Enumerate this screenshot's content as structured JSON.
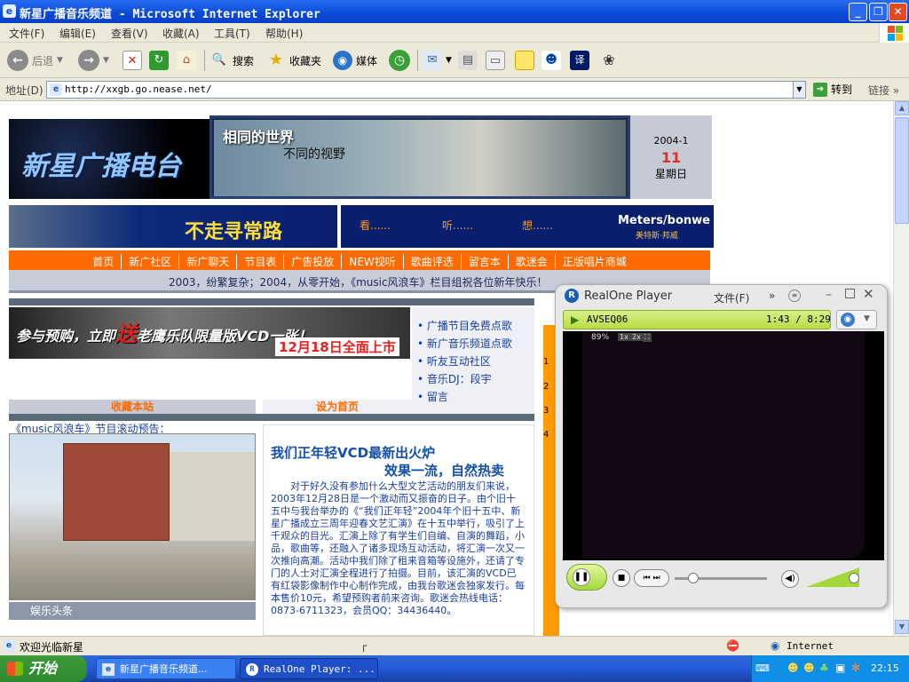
{
  "window": {
    "title": "新星广播音乐频道 - Microsoft Internet Explorer",
    "ie_icon": "ie-icon"
  },
  "menu": [
    "文件(F)",
    "编辑(E)",
    "查看(V)",
    "收藏(A)",
    "工具(T)",
    "帮助(H)"
  ],
  "toolbar": {
    "back": "后退",
    "search": "搜索",
    "favorites": "收藏夹",
    "media": "媒体"
  },
  "address": {
    "label": "地址(D)",
    "url": "http://xxgb.go.nease.net/",
    "go": "转到",
    "links": "链接"
  },
  "site": {
    "logo_text": "新星广播电台",
    "slogan_1": "相同的世界",
    "slogan_2": "不同的视野",
    "date": "2004-1",
    "day": "11",
    "weekday": "星期日",
    "ad_text": "不走寻常路",
    "ad_look": "看......",
    "ad_listen": "听......",
    "ad_think": "想......",
    "ad_brand": "Meters/bonwe",
    "ad_brand_cn": "美特斯·邦威",
    "nav": [
      "首页",
      "新广社区",
      "新广聊天",
      "节目表",
      "广告投放",
      "NEW视听",
      "歌曲评选",
      "留言本",
      "歌迷会",
      "正版唱片商城"
    ],
    "marquee": "2003，纷繁复杂；2004，从零开始，《music风浪车》栏目组祝各位新年快乐！",
    "promo_1": "参与预购，立即",
    "promo_send": "送",
    "promo_2": "老鹰乐队限量版VCD一张！",
    "promo_date": "12月18日全面上市",
    "side_links": [
      "广播节目免费点歌",
      "新广音乐频道点歌",
      "听友互动社区",
      "音乐DJ：段宇",
      "留言"
    ],
    "bookmark": "收藏本站",
    "set_home": "设为首页",
    "preview_title": "《music风浪车》节目滚动预告：",
    "ent_head": "娱乐头条",
    "num_list": [
      "1",
      "2",
      "3",
      "4"
    ],
    "article_title_1": "我们正年轻VCD最新出火炉",
    "article_title_2": "效果一流，自然热卖",
    "article_body": "对于好久没有参加什么大型文艺活动的朋友们来说，2003年12月28日是一个激动而又振奋的日子。由个旧十五中与我台举办的《“我们正年轻”2004年个旧十五中、新星广播成立三周年迎春文艺汇演》在十五中举行，吸引了上千观众的目光。汇演上除了有学生们自编、自演的舞蹈，小品，歌曲等，还融入了诸多现场互动活动，将汇演一次又一次推向高潮。活动中我们除了租来音箱等设施外，还请了专门的人士对汇演全程进行了拍摄。目前，该汇演的VCD已有红袋影像制作中心制作完成，由我台歌迷会独家发行。每本售价10元，希望预购者前来咨询。歌迷会热线电话：0873-6711323，会员QQ：34436440。"
  },
  "realone": {
    "title": "RealOne Player",
    "file_menu": "文件(F)",
    "track": "AVSEQ06",
    "time": "1:43 / 8:29",
    "zoom": "89%",
    "z1": "1x",
    "z2": "2x",
    "progress": 0.2,
    "volume": 0.9
  },
  "status": {
    "text": "欢迎光临新星",
    "zone": "Internet"
  },
  "taskbar": {
    "start": "开始",
    "task1": "新星广播音乐频道...",
    "task2": "RealOne Player: ...",
    "clock": "22:15"
  }
}
